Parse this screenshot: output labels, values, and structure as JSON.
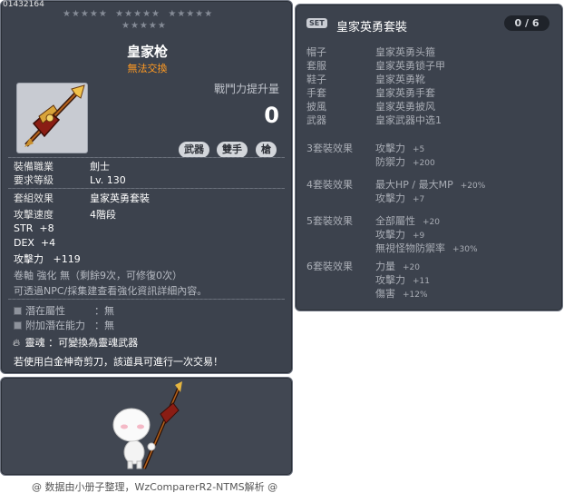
{
  "item": {
    "id": "01432164",
    "name": "皇家枪",
    "trade_note": "無法交換",
    "power_label": "戰鬥力提升量",
    "power_value": "0",
    "tags": [
      "武器",
      "雙手",
      "槍"
    ],
    "job_label": "裝備職業",
    "job_value": "劍士",
    "level_label": "要求等級",
    "level_value": "Lv. 130",
    "set_label": "套組效果",
    "set_value": "皇家英勇套裝",
    "speed_label": "攻擊速度",
    "speed_value": "4階段",
    "stats": [
      {
        "name": "STR",
        "value": "+8"
      },
      {
        "name": "DEX",
        "value": "+4"
      },
      {
        "name": "攻擊力",
        "value": "+119"
      }
    ],
    "scroll_text": "卷軸 強化 無（剩餘9次，可修復0次）",
    "npc_text": "可透過NPC/採集建查看強化資訊詳細內容。",
    "potential_label": "潛在屬性",
    "potential_value": "：無",
    "add_potential_label": "附加潛在能力",
    "add_potential_value": "：無",
    "soul_label": "靈魂",
    "soul_value": "：可變換為靈魂武器",
    "scissors_note": "若使用白金神奇剪刀，該道具可進行一次交易！"
  },
  "set": {
    "badge": "SET",
    "name": "皇家英勇套裝",
    "count": "0 / 6",
    "pieces": [
      {
        "slot": "帽子",
        "name": "皇家英勇头箍"
      },
      {
        "slot": "套服",
        "name": "皇家英勇锁子甲"
      },
      {
        "slot": "鞋子",
        "name": "皇家英勇靴"
      },
      {
        "slot": "手套",
        "name": "皇家英勇手套"
      },
      {
        "slot": "披風",
        "name": "皇家英勇披风"
      },
      {
        "slot": "武器",
        "name": "皇家武器中选1"
      }
    ],
    "effects": [
      {
        "title": "3套裝效果",
        "lines": [
          {
            "stat": "攻擊力",
            "val": "+5"
          },
          {
            "stat": "防禦力",
            "val": "+200"
          }
        ]
      },
      {
        "title": "4套裝效果",
        "lines": [
          {
            "stat": "最大HP / 最大MP",
            "val": "+20%"
          },
          {
            "stat": "攻擊力",
            "val": "+7"
          }
        ]
      },
      {
        "title": "5套裝效果",
        "lines": [
          {
            "stat": "全部屬性",
            "val": "+20"
          },
          {
            "stat": "攻擊力",
            "val": "+9"
          },
          {
            "stat": "無視怪物防禦率",
            "val": "+30%"
          }
        ]
      },
      {
        "title": "6套裝效果",
        "lines": [
          {
            "stat": "力量",
            "val": "+20"
          },
          {
            "stat": "攻擊力",
            "val": "+11"
          },
          {
            "stat": "傷害",
            "val": "+12%"
          }
        ]
      }
    ]
  },
  "footer": "@ 数据由小册子整理，WzComparerR2-NTMS解析 @",
  "colors": {
    "panel_bg": "#3c424d",
    "trade_note": "#ff9a22",
    "dim_text": "#a9adb5"
  },
  "icons": [
    "spear-item-icon",
    "potential-icon",
    "soul-flame-icon",
    "character-preview"
  ]
}
